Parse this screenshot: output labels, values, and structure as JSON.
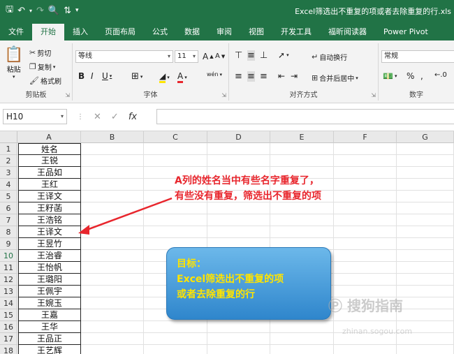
{
  "title_bar": {
    "doc_title": "Excel筛选出不重复的项或者去除重复的行.xls"
  },
  "tabs": [
    {
      "label": "文件"
    },
    {
      "label": "开始"
    },
    {
      "label": "插入"
    },
    {
      "label": "页面布局"
    },
    {
      "label": "公式"
    },
    {
      "label": "数据"
    },
    {
      "label": "审阅"
    },
    {
      "label": "视图"
    },
    {
      "label": "开发工具"
    },
    {
      "label": "福昕阅读器"
    },
    {
      "label": "Power Pivot"
    }
  ],
  "ribbon": {
    "clipboard": {
      "paste": "粘贴",
      "cut": "剪切",
      "copy": "复制",
      "format_painter": "格式刷",
      "group_label": "剪贴板"
    },
    "font": {
      "font_name": "等线",
      "font_size": "11",
      "grow": "A",
      "shrink": "A",
      "bold": "B",
      "italic": "I",
      "underline": "U",
      "font_color": "A",
      "phonetic": "wén",
      "group_label": "字体"
    },
    "alignment": {
      "wrap_text": "自动换行",
      "merge_center": "合并后居中",
      "group_label": "对齐方式"
    },
    "number": {
      "format": "常规",
      "percent": "%",
      "comma": ",",
      "group_label": "数字"
    }
  },
  "formula_bar": {
    "name_box": "H10",
    "fx": "fx",
    "value": ""
  },
  "grid": {
    "columns": [
      "A",
      "B",
      "C",
      "D",
      "E",
      "F",
      "G"
    ],
    "rows": [
      "1",
      "2",
      "3",
      "4",
      "5",
      "6",
      "7",
      "8",
      "9",
      "10",
      "11",
      "12",
      "13",
      "14",
      "15",
      "16",
      "17",
      "18"
    ],
    "column_a": [
      "姓名",
      "王锐",
      "王品如",
      "王红",
      "王译文",
      "王籽菡",
      "王浩铭",
      "王译文",
      "王昱竹",
      "王治睿",
      "王怡帆",
      "王璐阳",
      "王佩宇",
      "王婉玉",
      "王嘉",
      "王华",
      "王品正",
      "王艺辉"
    ]
  },
  "annotation": {
    "line1": "A列的姓名当中有些名字重复了，",
    "line2": "有些没有重复，筛选出不重复的项"
  },
  "callout": {
    "line1": "目标：",
    "line2": "Excel筛选出不重复的项",
    "line3": "或者去除重复的行"
  },
  "watermark": {
    "text": "搜狗指南",
    "sub": "zhinan.sogou.com"
  },
  "colors": {
    "excel_green": "#217346",
    "annotation_red": "#e8262d",
    "callout_blue": "#2f86cc",
    "callout_text": "#ffe400"
  }
}
